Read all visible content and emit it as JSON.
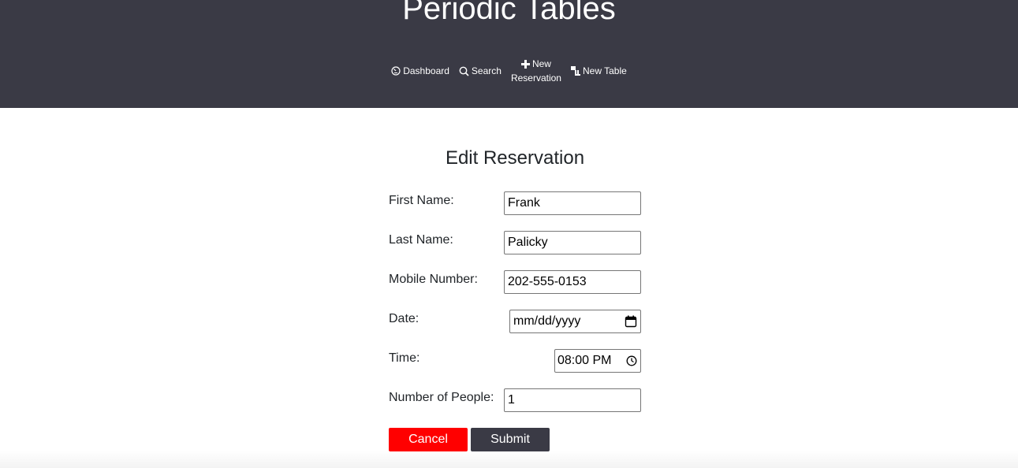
{
  "app": {
    "title": "Periodic Tables"
  },
  "nav": {
    "dashboard": "Dashboard",
    "search": "Search",
    "new_reservation_line1": "New",
    "new_reservation_line2": "Reservation",
    "new_table": "New Table",
    "icons": [
      "dashboard-icon",
      "search-icon",
      "plus-icon",
      "table-icon"
    ]
  },
  "form": {
    "title": "Edit Reservation",
    "fields": [
      {
        "label": "First Name:",
        "value": "Frank"
      },
      {
        "label": "Last Name:",
        "value": "Palicky"
      },
      {
        "label": "Mobile Number:",
        "value": "202-555-0153"
      },
      {
        "label": "Date:",
        "value": "mm/dd/yyyy"
      },
      {
        "label": "Time:",
        "value": "08:00 PM"
      },
      {
        "label": "Number of People:",
        "value": "1"
      }
    ],
    "cancel_label": "Cancel",
    "submit_label": "Submit"
  },
  "colors": {
    "header_bg": "#3a3a45",
    "cancel_bg": "#ff0000",
    "submit_bg": "#3a3a45"
  }
}
